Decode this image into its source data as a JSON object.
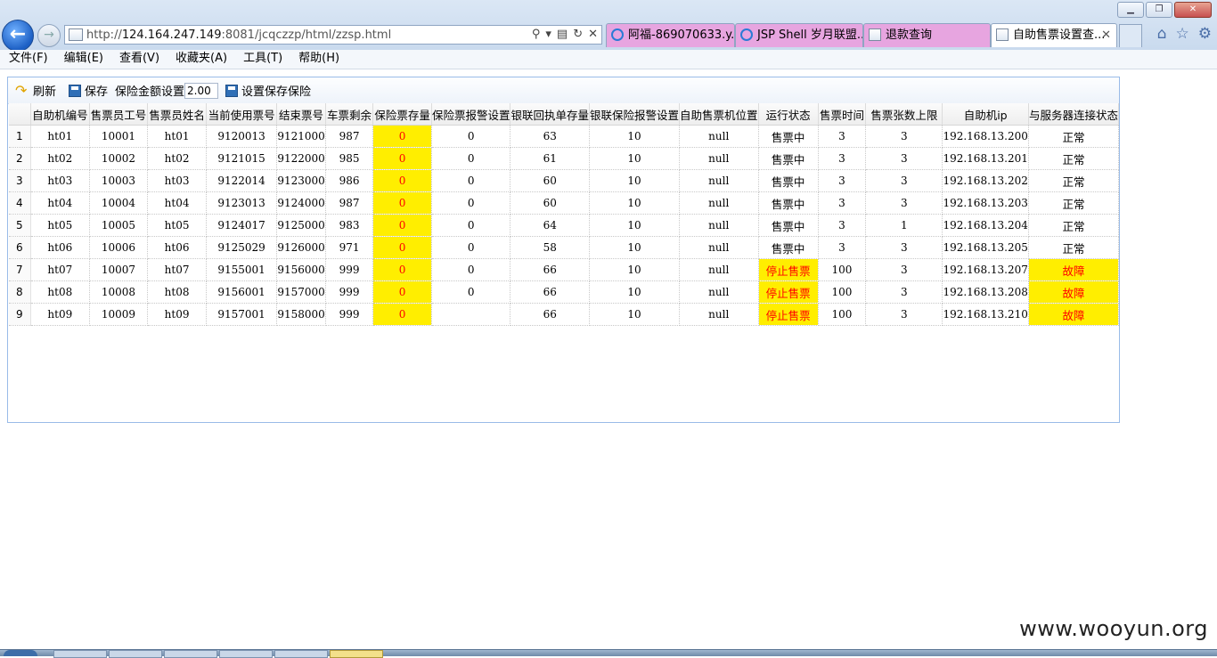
{
  "browser": {
    "url_prefix": "http://",
    "url_host": "124.164.247.149",
    "url_rest": ":8081/jcqczzp/html/zzsp.html",
    "tabs": [
      {
        "label": "阿福-869070633.y...",
        "color": "#e7a5e0",
        "icon": "ie-icon"
      },
      {
        "label": "JSP Shell 岁月联盟...",
        "color": "#e7a5e0",
        "icon": "ie-icon"
      },
      {
        "label": "退款查询",
        "color": "#e7a5e0",
        "icon": "image-icon"
      },
      {
        "label": "自助售票设置查...",
        "color": "#ffffff",
        "icon": "image-icon",
        "active": true
      }
    ]
  },
  "menubar": {
    "items": [
      "文件(F)",
      "编辑(E)",
      "查看(V)",
      "收藏夹(A)",
      "工具(T)",
      "帮助(H)"
    ]
  },
  "toolbar": {
    "refresh_label": "刷新",
    "save_label": "保存",
    "insurance_amount_label": "保险金额设置",
    "insurance_amount_value": "2.00",
    "save_insurance_label": "设置保存保险"
  },
  "grid": {
    "columns": [
      "自助机编号",
      "售票员工号",
      "售票员姓名",
      "当前使用票号",
      "结束票号",
      "车票剩余",
      "保险票存量",
      "保险票报警设置",
      "银联回执单存量",
      "银联保险报警设置",
      "自助售票机位置",
      "运行状态",
      "售票时间",
      "售票张数上限",
      "自助机ip",
      "与服务器连接状态"
    ],
    "rows": [
      {
        "num": "1",
        "cells": [
          "ht01",
          "10001",
          "ht01",
          "9120013",
          "9121000",
          "987",
          "0",
          "0",
          "63",
          "10",
          "null",
          "售票中",
          "3",
          "3",
          "192.168.13.200",
          "正常"
        ],
        "alert": false
      },
      {
        "num": "2",
        "cells": [
          "ht02",
          "10002",
          "ht02",
          "9121015",
          "9122000",
          "985",
          "0",
          "0",
          "61",
          "10",
          "null",
          "售票中",
          "3",
          "3",
          "192.168.13.201",
          "正常"
        ],
        "alert": false
      },
      {
        "num": "3",
        "cells": [
          "ht03",
          "10003",
          "ht03",
          "9122014",
          "9123000",
          "986",
          "0",
          "0",
          "60",
          "10",
          "null",
          "售票中",
          "3",
          "3",
          "192.168.13.202",
          "正常"
        ],
        "alert": false
      },
      {
        "num": "4",
        "cells": [
          "ht04",
          "10004",
          "ht04",
          "9123013",
          "9124000",
          "987",
          "0",
          "0",
          "60",
          "10",
          "null",
          "售票中",
          "3",
          "3",
          "192.168.13.203",
          "正常"
        ],
        "alert": false
      },
      {
        "num": "5",
        "cells": [
          "ht05",
          "10005",
          "ht05",
          "9124017",
          "9125000",
          "983",
          "0",
          "0",
          "64",
          "10",
          "null",
          "售票中",
          "3",
          "1",
          "192.168.13.204",
          "正常"
        ],
        "alert": false
      },
      {
        "num": "6",
        "cells": [
          "ht06",
          "10006",
          "ht06",
          "9125029",
          "9126000",
          "971",
          "0",
          "0",
          "58",
          "10",
          "null",
          "售票中",
          "3",
          "3",
          "192.168.13.205",
          "正常"
        ],
        "alert": false
      },
      {
        "num": "7",
        "cells": [
          "ht07",
          "10007",
          "ht07",
          "9155001",
          "9156000",
          "999",
          "0",
          "0",
          "66",
          "10",
          "null",
          "停止售票",
          "100",
          "3",
          "192.168.13.207",
          "故障"
        ],
        "alert": true
      },
      {
        "num": "8",
        "cells": [
          "ht08",
          "10008",
          "ht08",
          "9156001",
          "9157000",
          "999",
          "0",
          "0",
          "66",
          "10",
          "null",
          "停止售票",
          "100",
          "3",
          "192.168.13.208",
          "故障"
        ],
        "alert": true
      },
      {
        "num": "9",
        "cells": [
          "ht09",
          "10009",
          "ht09",
          "9157001",
          "9158000",
          "999",
          "0",
          "",
          "66",
          "10",
          "null",
          "停止售票",
          "100",
          "3",
          "192.168.13.210",
          "故障"
        ],
        "alert": true
      }
    ]
  },
  "watermark": "www.wooyun.org",
  "colors": {
    "highlight": "#ffee00",
    "alert_text": "#ff0000"
  }
}
